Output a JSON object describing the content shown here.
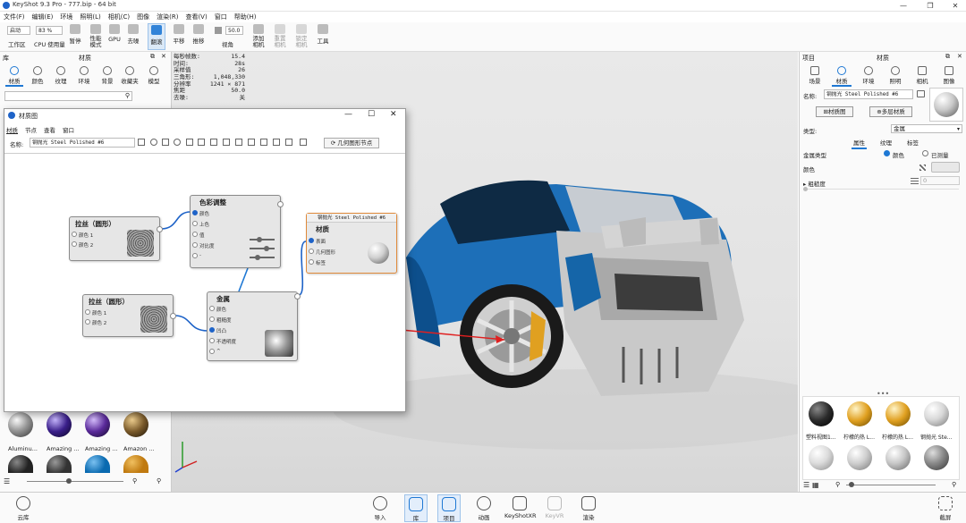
{
  "app": {
    "title": "KeyShot 9.3 Pro  -  777.bip  -  64 bit"
  },
  "menu": [
    "文件(F)",
    "编辑(E)",
    "环境",
    "照明(L)",
    "相机(C)",
    "图像",
    "渲染(R)",
    "查看(V)",
    "窗口",
    "帮助(H)"
  ],
  "toolbar": {
    "workspace_value": "启动",
    "workspace_label": "工作区",
    "cpu_value": "83 %",
    "cpu_label": "CPU 使用量",
    "pause": "暂停",
    "perf_mode": "性能\n模式",
    "gpu": "GPU",
    "denoise": "去噪",
    "refresh": "翻滚",
    "pan": "平移",
    "dolly": "推移",
    "fov_value": "50.0",
    "view": "视角",
    "add_camera": "添加\n相机",
    "reset_camera": "重置\n相机",
    "lock_camera": "锁定\n相机",
    "tools": "工具"
  },
  "hud": [
    {
      "k": "每秒帧数:",
      "v": "15.4"
    },
    {
      "k": "时间:",
      "v": "28s"
    },
    {
      "k": "采样值",
      "v": "26"
    },
    {
      "k": "三角形:",
      "v": "1,048,330"
    },
    {
      "k": "分辨率",
      "v": "1241 × 871"
    },
    {
      "k": "焦距",
      "v": "50.0"
    },
    {
      "k": "去噪:",
      "v": "关"
    }
  ],
  "library": {
    "header_left": "库",
    "header_title": "材质",
    "tabs": [
      "材质",
      "颜色",
      "纹理",
      "环境",
      "背景",
      "收藏夹",
      "模型"
    ],
    "active_tab": 0,
    "materials": [
      {
        "name": "Aluminu...",
        "color": "#9a9a9a"
      },
      {
        "name": "Amazing ...",
        "color": "#3a1f8a"
      },
      {
        "name": "Amazing ...",
        "color": "#5a2a9a"
      },
      {
        "name": "Amazon ...",
        "color": "#7a5a2a"
      }
    ],
    "row2_colors": [
      "#222",
      "#333",
      "#0a6ab0",
      "#c07a10"
    ]
  },
  "material_graph": {
    "title": "材质图",
    "menu": [
      "材质",
      "节点",
      "查看",
      "窗口"
    ],
    "name_label": "名称:",
    "name_value": "钢抛光 Steel Polished #6",
    "geometry_button": "几何图形节点",
    "nodes": {
      "brush1": {
        "title": "拉丝（圆形）",
        "ports": [
          "颜色 1",
          "颜色 2"
        ]
      },
      "color_adjust": {
        "title": "色彩调整",
        "ports": [
          "颜色",
          "上色",
          "值",
          "对比度",
          "-"
        ]
      },
      "brush2": {
        "title": "拉丝（圆形）",
        "ports": [
          "颜色 1",
          "颜色 2"
        ]
      },
      "metal": {
        "title": "金属",
        "ports": [
          "颜色",
          "粗糙度",
          "凹凸",
          "不透明度",
          "^"
        ]
      },
      "material": {
        "header": "钢抛光 Steel Polished #6",
        "title": "材质",
        "ports": [
          "表面",
          "几何图形",
          "标签"
        ]
      }
    }
  },
  "project": {
    "header_left": "项目",
    "header_title": "材质",
    "tabs": [
      "场景",
      "材质",
      "环境",
      "照明",
      "相机",
      "图像"
    ],
    "active_tab": 1,
    "name_label": "名称:",
    "name_value": "钢抛光 Steel Polished #6",
    "graph_btn": "材质图",
    "multilayer_btn": "多层材质",
    "type_label": "类型:",
    "type_value": "金属",
    "subtabs": [
      "属性",
      "纹理",
      "标签"
    ],
    "metal_type_label": "金属类型",
    "opt_color": "颜色",
    "opt_measured": "已测量",
    "color_label": "颜色",
    "roughness_label": "粗糙度",
    "roughness_value": "0",
    "balls": [
      {
        "name": "塑料视图1...",
        "color": "#2a2a2a"
      },
      {
        "name": "柠檬的热 L...",
        "color": "#e0a020"
      },
      {
        "name": "柠檬的热 L...",
        "color": "#e0a020"
      },
      {
        "name": "钢抛光 Ste...",
        "color": "#d8d8d8"
      }
    ],
    "row2_colors": [
      "#dcdcdc",
      "#cfcfcf",
      "#c8c8c8",
      "#8a8a8a"
    ]
  },
  "bottom": {
    "cloud": "云库",
    "import": "导入",
    "library": "库",
    "project": "项目",
    "animation": "动画",
    "keyshotxr": "KeyShotXR",
    "keyvr": "KeyVR",
    "render": "渲染",
    "screenshot": "截屏"
  }
}
